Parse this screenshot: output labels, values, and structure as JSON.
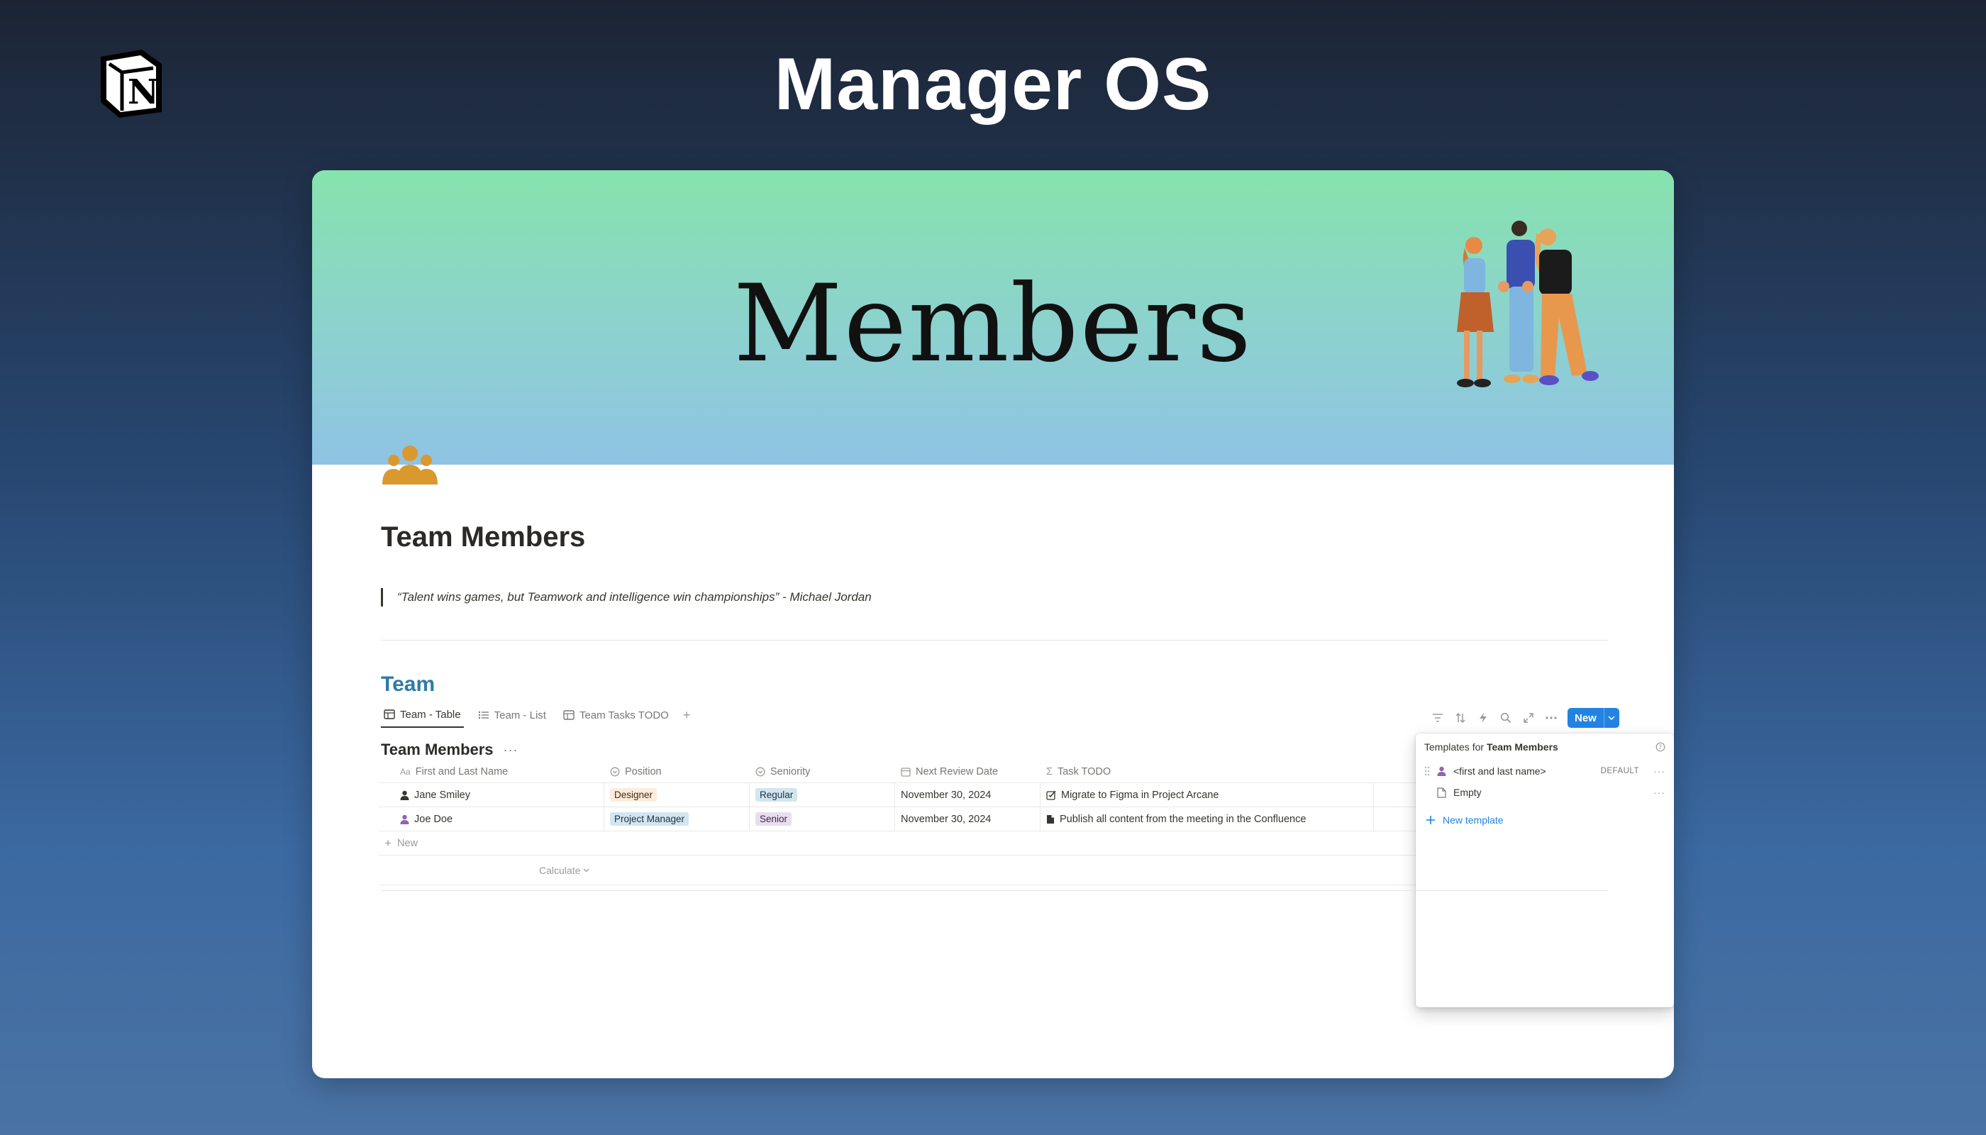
{
  "banner": {
    "title": "Manager OS",
    "logo_icon": "notion-logo-icon"
  },
  "cover": {
    "title": "Members",
    "illustration": "team-people-illustration"
  },
  "page": {
    "icon": "people-group-icon",
    "title": "Team Members",
    "quote": "“Talent wins games, but Teamwork and intelligence win championships” - Michael Jordan"
  },
  "section": {
    "heading": "Team"
  },
  "views": [
    {
      "label": "Team - Table",
      "icon": "table-icon",
      "active": true
    },
    {
      "label": "Team - List",
      "icon": "list-icon",
      "active": false
    },
    {
      "label": "Team Tasks TODO",
      "icon": "table-icon",
      "active": false
    }
  ],
  "toolbar": {
    "icons": [
      "filter-icon",
      "sort-icon",
      "automation-icon",
      "search-icon",
      "expand-icon",
      "more-icon"
    ],
    "new_label": "New",
    "accent": "#2383e2"
  },
  "database": {
    "title": "Team Members",
    "columns": [
      {
        "label": "First and Last Name",
        "icon": "text-icon",
        "icon_text": "Aa"
      },
      {
        "label": "Position",
        "icon": "select-icon"
      },
      {
        "label": "Seniority",
        "icon": "select-icon"
      },
      {
        "label": "Next Review Date",
        "icon": "calendar-icon"
      },
      {
        "label": "Task TODO",
        "icon": "formula-icon",
        "icon_text": "Σ"
      }
    ],
    "rows": [
      {
        "name": "Jane Smiley",
        "position": "Designer",
        "seniority": "Regular",
        "review_date": "November 30, 2024",
        "task": "Migrate to Figma in Project Arcane"
      },
      {
        "name": "Joe Doe",
        "position": "Project Manager",
        "seniority": "Senior",
        "review_date": "November 30, 2024",
        "task": "Publish all content from the meeting in the Confluence"
      }
    ],
    "new_row_label": "New",
    "calculate_label": "Calculate"
  },
  "templates_menu": {
    "prefix": "Templates for",
    "target": "Team Members",
    "items": [
      {
        "label": "<first and last name>",
        "badge": "DEFAULT",
        "icon": "person-icon"
      },
      {
        "label": "Empty",
        "badge": "",
        "icon": "page-icon"
      }
    ],
    "new_template_label": "New template"
  }
}
